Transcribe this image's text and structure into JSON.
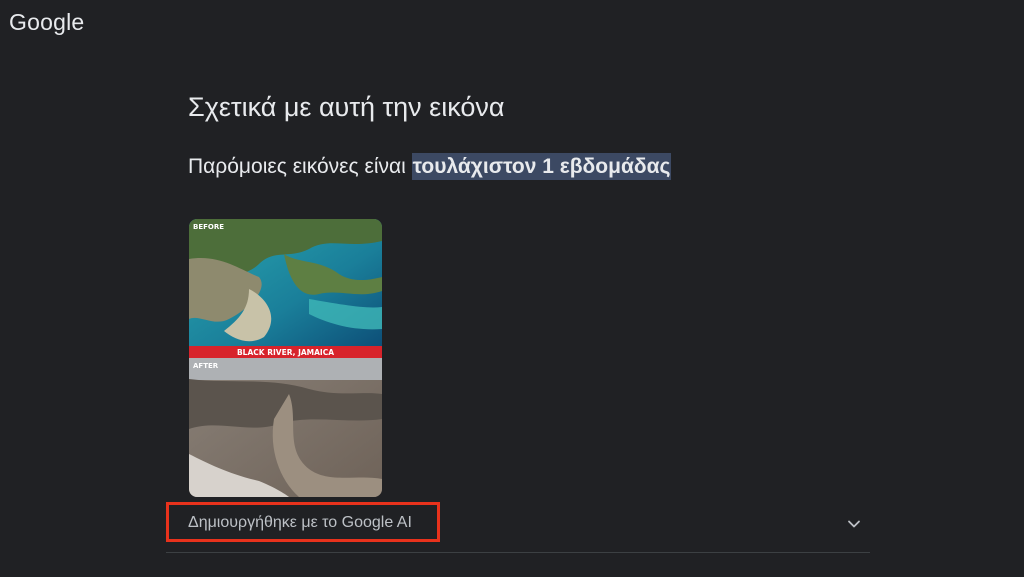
{
  "header": {
    "logo_text": "Google"
  },
  "main": {
    "title": "Σχετικά με αυτή την εικόνα",
    "similar_prefix": "Παρόμοιες εικόνες είναι ",
    "similar_highlight": "τουλάχιστον 1 εβδομάδας",
    "image": {
      "top_label": "BEFORE",
      "banner_label": "BLACK RIVER, JAMAICA",
      "bottom_label": "AFTER"
    },
    "ai_section": {
      "label": "Δημιουργήθηκε με το Google AI",
      "icon": "chevron-down-icon"
    }
  },
  "colors": {
    "background": "#202124",
    "highlight": "#3c4963",
    "annotation_box": "#e8321c",
    "banner_red": "#d7232b"
  }
}
